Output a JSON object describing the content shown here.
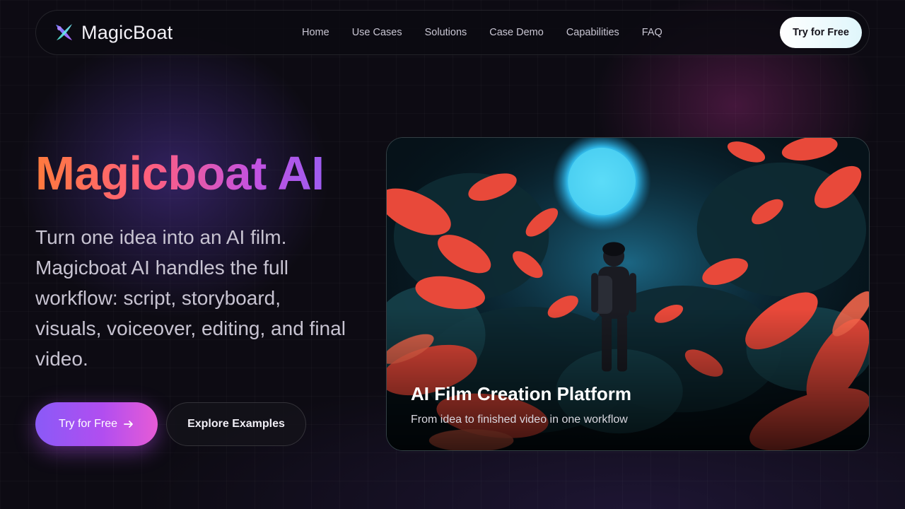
{
  "brand": {
    "name": "MagicBoat",
    "logo_icon": "magicboat-logo-icon"
  },
  "nav": {
    "links": [
      "Home",
      "Use Cases",
      "Solutions",
      "Case Demo",
      "Capabilities",
      "FAQ"
    ],
    "cta_label": "Try for Free"
  },
  "hero": {
    "title": "Magicboat AI",
    "description": "Turn one idea into an AI film. Magicboat AI handles the full workflow: script, storyboard, visuals, voiceover, editing, and final video.",
    "primary_button": "Try for Free",
    "primary_button_icon": "arrow-right-icon",
    "secondary_button": "Explore Examples"
  },
  "media_card": {
    "image_description_icon": "forest-scene-image",
    "title": "AI Film Creation Platform",
    "subtitle": "From idea to finished video in one workflow"
  },
  "colors": {
    "title_gradient": [
      "#ff7a3d",
      "#ff5f7e",
      "#c452e0",
      "#9d5cf0"
    ],
    "primary_button_gradient": [
      "#8a5af7",
      "#b14ef0",
      "#e65bd6"
    ],
    "background": "#0d0b13"
  }
}
